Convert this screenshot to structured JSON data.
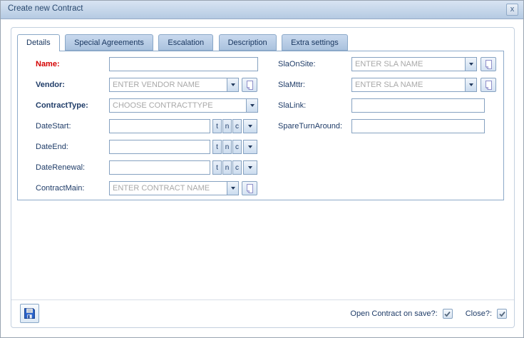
{
  "window": {
    "title": "Create new Contract",
    "close_glyph": "x"
  },
  "tabs": {
    "active": "Details",
    "items": [
      {
        "label": "Details"
      },
      {
        "label": "Special Agreements"
      },
      {
        "label": "Escalation"
      },
      {
        "label": "Description"
      },
      {
        "label": "Extra settings"
      }
    ]
  },
  "form": {
    "date_buttons": {
      "today": "t",
      "now": "n",
      "clear": "c"
    },
    "fields": {
      "name": {
        "label": "Name:",
        "value": "",
        "required": true
      },
      "vendor": {
        "label": "Vendor:",
        "value": "",
        "placeholder": "ENTER VENDOR NAME"
      },
      "contract_type": {
        "label": "ContractType:",
        "value": "",
        "placeholder": "CHOOSE CONTRACTTYPE"
      },
      "date_start": {
        "label": "DateStart:",
        "value": ""
      },
      "date_end": {
        "label": "DateEnd:",
        "value": ""
      },
      "date_renewal": {
        "label": "DateRenewal:",
        "value": ""
      },
      "contract_main": {
        "label": "ContractMain:",
        "value": "",
        "placeholder": "ENTER CONTRACT NAME"
      },
      "sla_on_site": {
        "label": "SlaOnSite:",
        "value": "",
        "placeholder": "ENTER SLA NAME"
      },
      "sla_mttr": {
        "label": "SlaMttr:",
        "value": "",
        "placeholder": "ENTER SLA NAME"
      },
      "sla_link": {
        "label": "SlaLink:",
        "value": ""
      },
      "spare_turn_around": {
        "label": "SpareTurnAround:",
        "value": ""
      }
    }
  },
  "footer": {
    "open_contract_label": "Open Contract on save?:",
    "open_contract_checked": true,
    "close_label": "Close?:",
    "close_checked": true
  },
  "icons": {
    "save": "floppy-disk",
    "new_record": "new-document-page",
    "dropdown": "caret-down",
    "checkbox": "check-mark"
  },
  "colors": {
    "titlebar": "#c3d5e9",
    "tab_inactive": "#b7cbe4",
    "panel_border": "#8ca9c9",
    "label": "#1f3c68",
    "required_label": "#d40000",
    "placeholder": "#a8a8a8",
    "save_icon_blue": "#2a63cc"
  }
}
